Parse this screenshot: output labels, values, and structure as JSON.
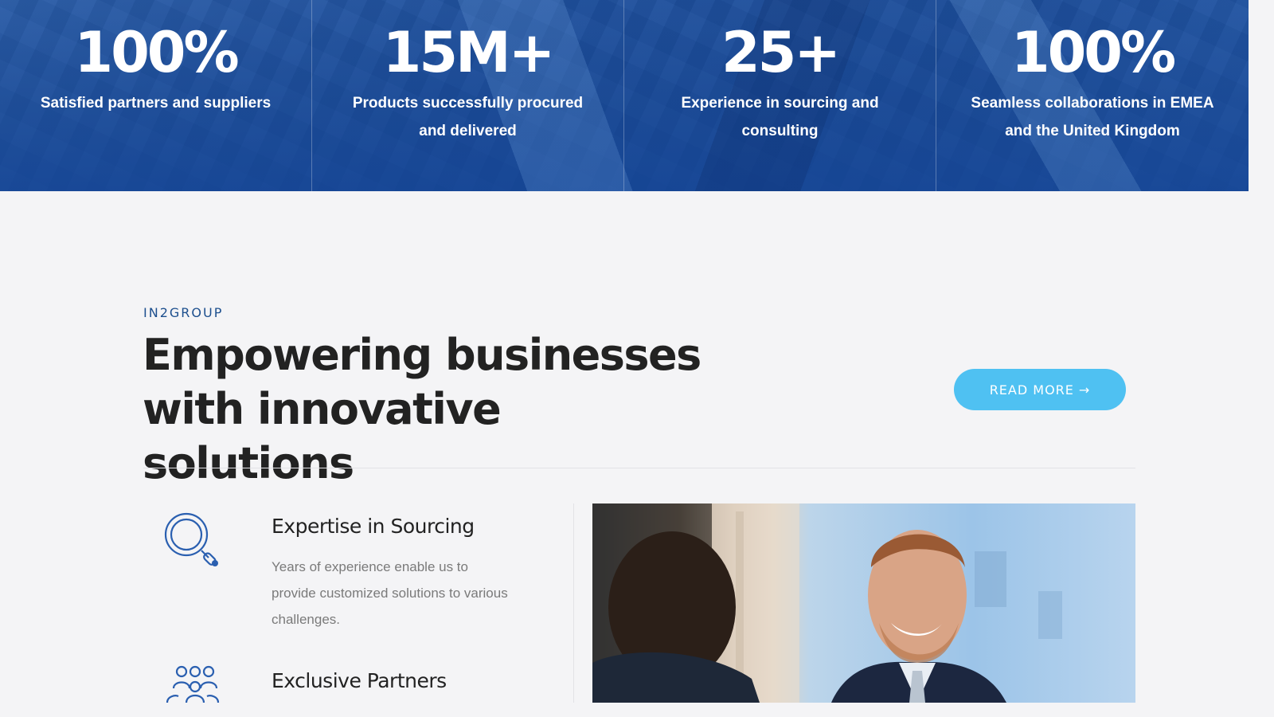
{
  "stats": [
    {
      "value": "100%",
      "label": "Satisfied partners and suppliers"
    },
    {
      "value": "15M+",
      "label": "Products successfully procured and delivered"
    },
    {
      "value": "25+",
      "label": "Experience in sourcing and consulting"
    },
    {
      "value": "100%",
      "label": "Seamless collaborations in EMEA and the United Kingdom"
    }
  ],
  "intro": {
    "eyebrow": "IN2GROUP",
    "headline": "Empowering businesses with innovative solutions",
    "read_more_label": "READ MORE",
    "read_more_arrow": "→"
  },
  "features": [
    {
      "title": "Expertise in Sourcing",
      "description": "Years of experience enable us to provide customized solutions to various challenges.",
      "icon": "magnifier-icon"
    },
    {
      "title": "Exclusive Partners",
      "description": "",
      "icon": "team-icon"
    }
  ],
  "photo": {
    "subject": "handshake-meeting-photo"
  },
  "colors": {
    "brand_blue": "#1d4f8e",
    "accent_cyan": "#4fc1f2",
    "background": "#f4f4f6"
  }
}
